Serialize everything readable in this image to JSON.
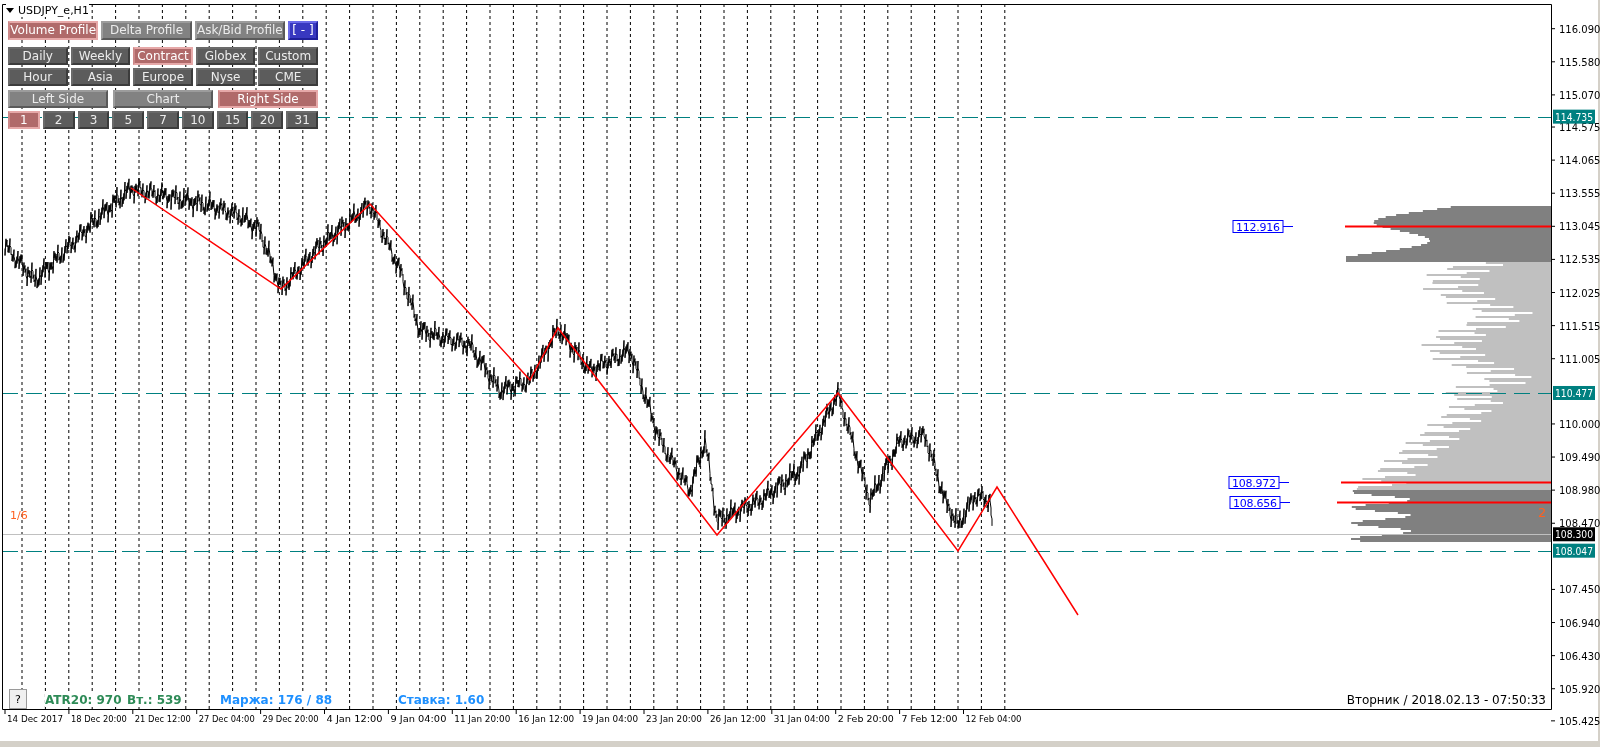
{
  "chart_title": "USDJPY_e,H1",
  "profile_buttons": [
    {
      "label": "Volume Profile",
      "selected": true
    },
    {
      "label": "Delta Profile",
      "selected": false
    },
    {
      "label": "Ask/Bid Profile",
      "selected": false
    }
  ],
  "collapse_button": "[ - ]",
  "period_rows": [
    {
      "buttons": [
        {
          "label": "Daily",
          "selected": false
        },
        {
          "label": "Weekly",
          "selected": false
        },
        {
          "label": "Contract",
          "selected": true
        },
        {
          "label": "Globex",
          "selected": false
        },
        {
          "label": "Custom",
          "selected": false
        }
      ]
    },
    {
      "buttons": [
        {
          "label": "Hour",
          "selected": false
        },
        {
          "label": "Asia",
          "selected": false
        },
        {
          "label": "Europe",
          "selected": false
        },
        {
          "label": "Nyse",
          "selected": false
        },
        {
          "label": "CME",
          "selected": false
        }
      ]
    }
  ],
  "side_buttons": [
    {
      "label": "Left Side",
      "selected": false
    },
    {
      "label": "Chart",
      "selected": false
    },
    {
      "label": "Right Side",
      "selected": true
    }
  ],
  "range_buttons": [
    {
      "label": "1",
      "selected": true
    },
    {
      "label": "2",
      "selected": false
    },
    {
      "label": "3",
      "selected": false
    },
    {
      "label": "5",
      "selected": false
    },
    {
      "label": "7",
      "selected": false
    },
    {
      "label": "10",
      "selected": false
    },
    {
      "label": "15",
      "selected": false
    },
    {
      "label": "20",
      "selected": false
    },
    {
      "label": "31",
      "selected": false
    }
  ],
  "price_axis": [
    "116.090",
    "115.580",
    "115.070",
    "114.575",
    "114.065",
    "113.555",
    "113.045",
    "112.535",
    "112.025",
    "111.515",
    "111.005",
    "110.000",
    "109.490",
    "108.980",
    "108.470",
    "107.450",
    "106.940",
    "106.430",
    "105.920",
    "105.425"
  ],
  "price_markers": [
    {
      "label": "114.735",
      "color": "#008080",
      "kind": "dashed"
    },
    {
      "label": "110.477",
      "color": "#008080",
      "kind": "dashed"
    },
    {
      "label": "108.300",
      "color": "#000000",
      "kind": "solid"
    },
    {
      "label": "108.047",
      "color": "#008080",
      "kind": "dashed"
    }
  ],
  "levels": [
    {
      "label": "112.916"
    },
    {
      "label": "108.972"
    },
    {
      "label": "108.656"
    }
  ],
  "time_axis": [
    "14 Dec 2017",
    "18 Dec 20:00",
    "21 Dec 12:00",
    "27 Dec 04:00",
    "29 Dec 20:00",
    "4 Jan 12:00",
    "9 Jan 04:00",
    "11 Jan 20:00",
    "16 Jan 12:00",
    "19 Jan 04:00",
    "23 Jan 20:00",
    "26 Jan 12:00",
    "31 Jan 04:00",
    "2 Feb 20:00",
    "7 Feb 12:00",
    "12 Feb 04:00"
  ],
  "bar_counter": "1/6",
  "profile_count": "2",
  "help_button": "?",
  "indicators": [
    {
      "label": "ATR20: 970",
      "color": "#2e8b57"
    },
    {
      "label": "Вт.: 539",
      "color": "#2e8b57"
    },
    {
      "label": "Маржа: 176 / 88",
      "color": "#1e90ff"
    },
    {
      "label": "Ставка: 1.60",
      "color": "#1e90ff"
    }
  ],
  "server_time": "Вторник / 2018.02.13 - 07:50:33"
}
